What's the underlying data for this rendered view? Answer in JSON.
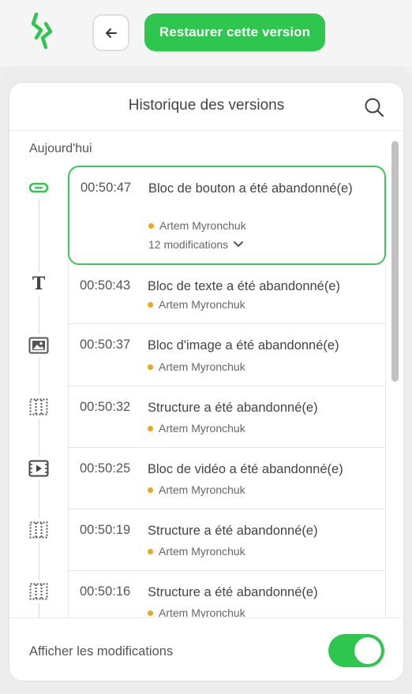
{
  "toolbar": {
    "logo_icon": "lightning-logo-icon",
    "back_icon": "arrow-left-icon",
    "restore_label": "Restaurer cette version",
    "accent_color": "#2fc64f"
  },
  "panel": {
    "title": "Historique des versions",
    "search_icon": "search-icon",
    "day_label": "Aujourd'hui",
    "entries": [
      {
        "time": "00:50:47",
        "title": "Bloc de bouton a été abandonné(e)",
        "author": "Artem Myronchuk",
        "modifications": "12 modifications",
        "icon": "button-block-icon",
        "active": true
      },
      {
        "time": "00:50:43",
        "title": "Bloc de texte a été abandonné(e)",
        "author": "Artem Myronchuk",
        "icon": "text-block-icon"
      },
      {
        "time": "00:50:37",
        "title": "Bloc d'image a été abandonné(e)",
        "author": "Artem Myronchuk",
        "icon": "image-block-icon"
      },
      {
        "time": "00:50:32",
        "title": "Structure a été abandonné(e)",
        "author": "Artem Myronchuk",
        "icon": "structure-icon"
      },
      {
        "time": "00:50:25",
        "title": "Bloc de vidéo a été abandonné(e)",
        "author": "Artem Myronchuk",
        "icon": "video-block-icon"
      },
      {
        "time": "00:50:19",
        "title": "Structure a été abandonné(e)",
        "author": "Artem Myronchuk",
        "icon": "structure-icon"
      },
      {
        "time": "00:50:16",
        "title": "Structure a été abandonné(e)",
        "author": "Artem Myronchuk",
        "icon": "structure-icon"
      }
    ]
  },
  "footer": {
    "label": "Afficher les modifications",
    "toggle_on": true
  }
}
